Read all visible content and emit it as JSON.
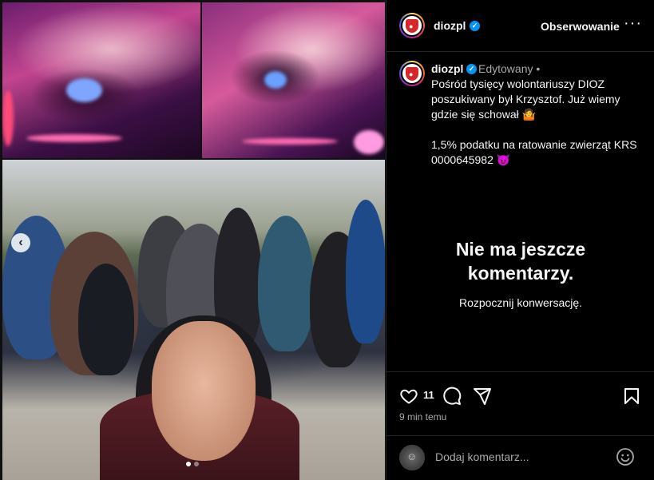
{
  "post": {
    "username": "diozpl",
    "verified_mark": "✓",
    "follow_label": "Obserwowanie",
    "more_label": "···",
    "edited_label": "Edytowany •",
    "caption_line1": "Pośród tysięcy wolontariuszy DIOZ",
    "caption_line2": "poszukiwany był Krzysztof. Już wiemy",
    "caption_line3": "gdzie się schował 🤷",
    "caption_line4": "1,5% podatku na ratowanie zwierząt KRS",
    "caption_line5": "0000645982 😈"
  },
  "comments": {
    "empty_title_line1": "Nie ma jeszcze",
    "empty_title_line2": "komentarzy.",
    "empty_subtitle": "Rozpocznij konwersację."
  },
  "actions": {
    "like_count": "11",
    "timestamp": "9 min temu"
  },
  "comment_box": {
    "placeholder": "Dodaj komentarz..."
  },
  "carousel": {
    "prev_glyph": "‹",
    "slides": 2,
    "active_slide": 1
  },
  "icons": {
    "like": "heart-icon",
    "comment": "comment-icon",
    "share": "share-icon",
    "save": "bookmark-icon",
    "emoji": "emoji-icon",
    "more": "more-icon"
  },
  "colors": {
    "background": "#000000",
    "verified": "#0095f6",
    "muted": "#a8a8a8",
    "brand": "#d62828"
  }
}
